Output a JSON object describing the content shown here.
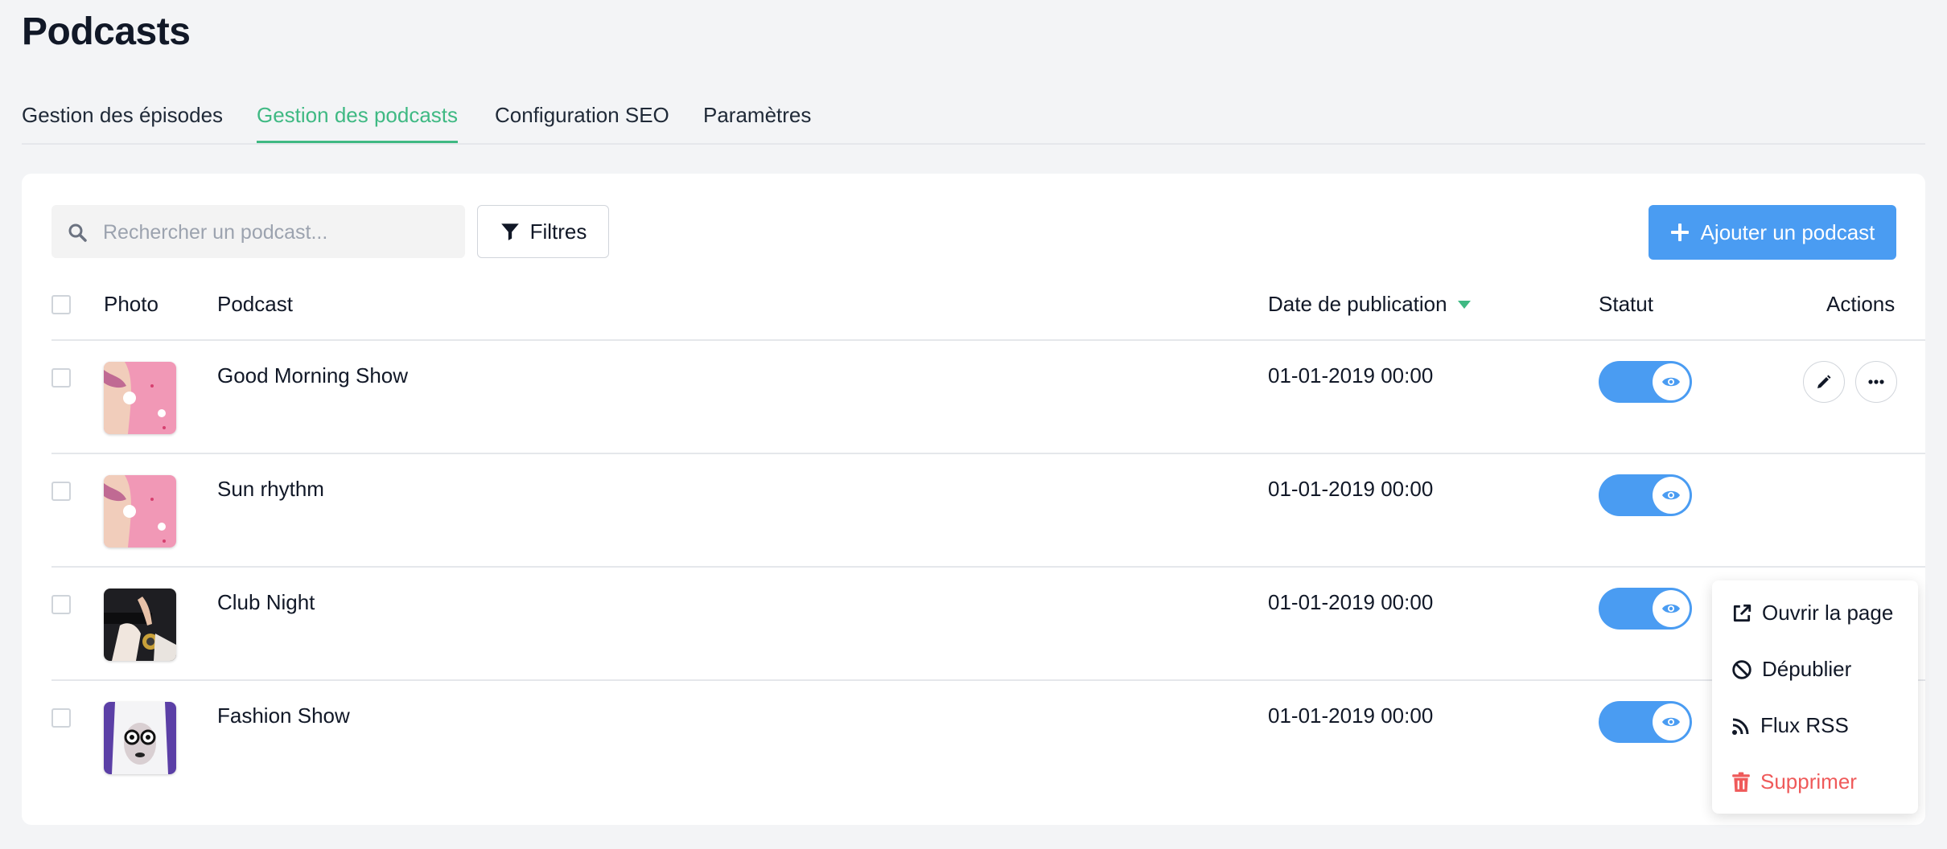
{
  "page": {
    "title": "Podcasts"
  },
  "tabs": [
    {
      "label": "Gestion des épisodes",
      "active": false
    },
    {
      "label": "Gestion des podcasts",
      "active": true
    },
    {
      "label": "Configuration SEO",
      "active": false
    },
    {
      "label": "Paramètres",
      "active": false
    }
  ],
  "toolbar": {
    "search_placeholder": "Rechercher un podcast...",
    "search_icon": "search-icon",
    "filter_label": "Filtres",
    "filter_icon": "filter-icon",
    "add_label": "Ajouter un podcast",
    "add_icon": "plus-icon"
  },
  "table": {
    "headers": {
      "photo": "Photo",
      "podcast": "Podcast",
      "date": "Date de publication",
      "status": "Statut",
      "actions": "Actions"
    },
    "sort": {
      "column": "date",
      "direction": "desc"
    },
    "rows": [
      {
        "name": "Good Morning Show",
        "date": "01-01-2019 00:00",
        "published": true
      },
      {
        "name": "Sun rhythm",
        "date": "01-01-2019 00:00",
        "published": true
      },
      {
        "name": "Club Night",
        "date": "01-01-2019 00:00",
        "published": true
      },
      {
        "name": "Fashion Show",
        "date": "01-01-2019 00:00",
        "published": true
      }
    ]
  },
  "menu": {
    "items": [
      {
        "label": "Ouvrir la page",
        "icon": "external-link-icon"
      },
      {
        "label": "Dépublier",
        "icon": "ban-icon"
      },
      {
        "label": "Flux RSS",
        "icon": "rss-icon"
      },
      {
        "label": "Supprimer",
        "icon": "trash-icon"
      }
    ]
  },
  "colors": {
    "accent_green": "#3fb983",
    "primary_blue": "#4a9cf2",
    "danger_red": "#ef5a5a",
    "background": "#f3f4f6"
  }
}
